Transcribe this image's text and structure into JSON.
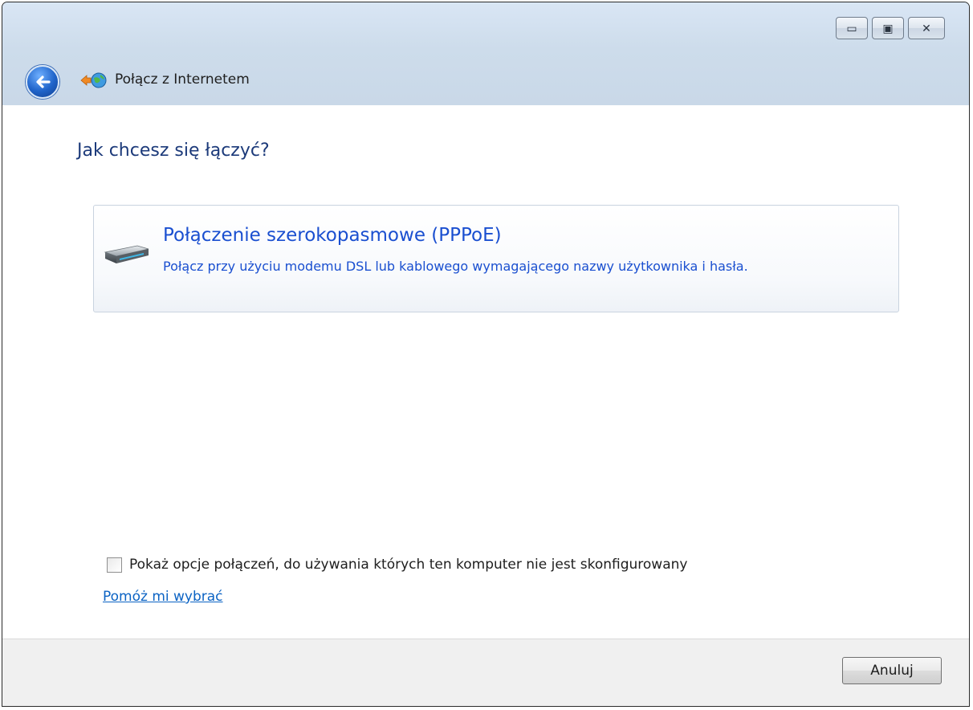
{
  "window": {
    "title": "Połącz z Internetem",
    "caption_buttons": {
      "minimize_glyph": "▭",
      "maximize_glyph": "▣",
      "close_glyph": "✕"
    }
  },
  "content": {
    "heading": "Jak chcesz się łączyć?",
    "option": {
      "title": "Połączenie szerokopasmowe (PPPoE)",
      "description": "Połącz przy użyciu modemu DSL lub kablowego wymagającego nazwy użytkownika i hasła."
    },
    "show_options_checkbox": {
      "label": "Pokaż opcje połączeń, do używania których ten komputer nie jest skonfigurowany",
      "checked": false
    },
    "help_link": "Pomóż mi wybrać"
  },
  "footer": {
    "cancel_label": "Anuluj"
  },
  "colors": {
    "heading": "#1c3a7a",
    "option_text": "#1a4fd0",
    "link": "#0b63c4"
  }
}
